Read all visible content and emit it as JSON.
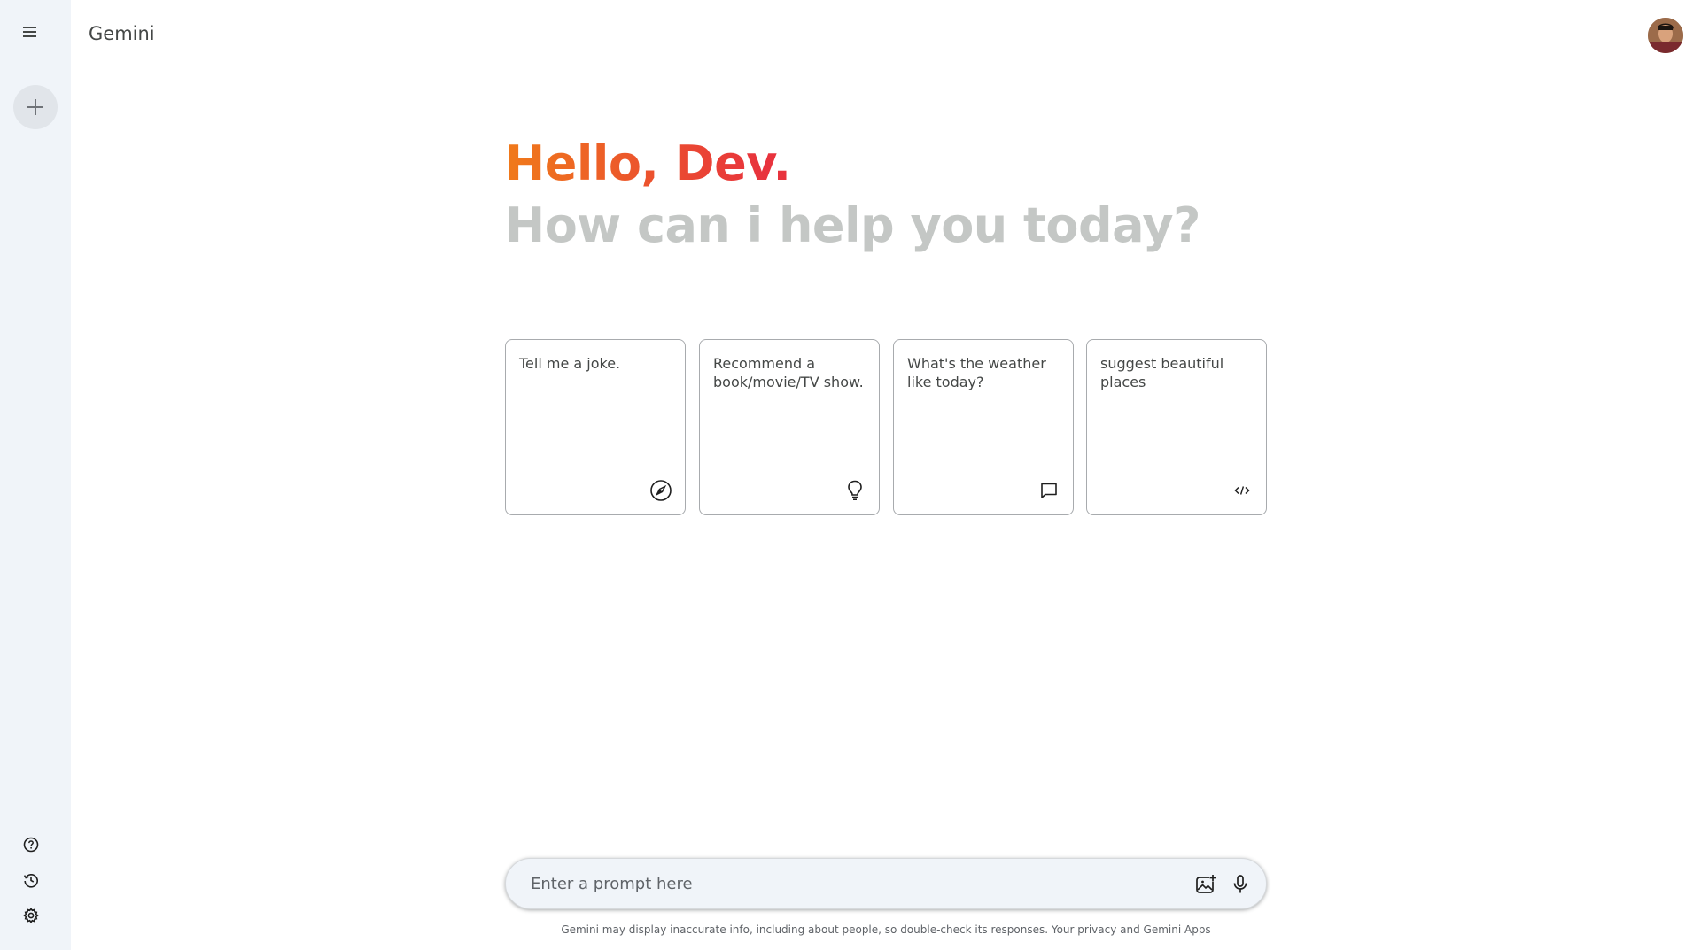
{
  "app": {
    "title": "Gemini"
  },
  "sidebar": {
    "menu_icon": "menu-icon",
    "new_chat_icon": "plus-icon",
    "bottom_items": [
      {
        "icon": "help-icon"
      },
      {
        "icon": "history-icon"
      },
      {
        "icon": "settings-icon"
      }
    ]
  },
  "header": {
    "avatar": "user-avatar"
  },
  "hero": {
    "greeting": "Hello, Dev.",
    "subtitle": "How can i help you today?",
    "greeting_colors": [
      "#f07a1a",
      "#e8333d"
    ]
  },
  "cards": [
    {
      "text": "Tell me a joke.",
      "icon": "compass-icon"
    },
    {
      "text": "Recommend a book/movie/TV show.",
      "icon": "lightbulb-icon"
    },
    {
      "text": "What's the weather like today?",
      "icon": "message-icon"
    },
    {
      "text": "suggest beautiful places",
      "icon": "code-icon"
    }
  ],
  "prompt": {
    "placeholder": "Enter a prompt here",
    "image_icon": "add-image-icon",
    "mic_icon": "mic-icon"
  },
  "footer": {
    "disclaimer": "Gemini may display inaccurate info, including about people, so double-check its responses. Your privacy and Gemini Apps"
  }
}
